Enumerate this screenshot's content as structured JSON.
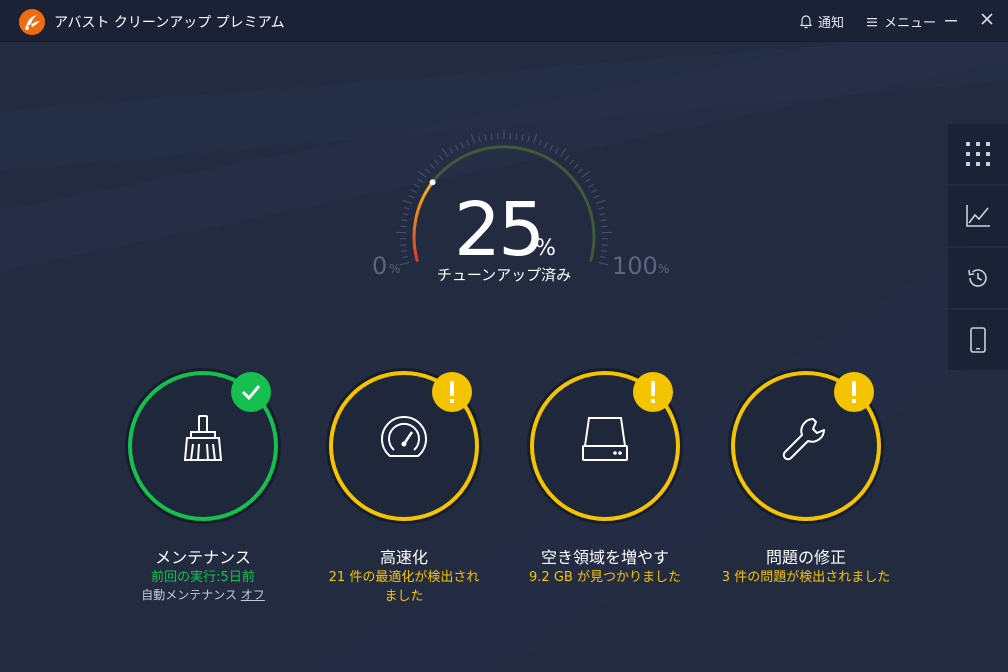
{
  "app": {
    "title": "アバスト クリーンアップ プレミアム",
    "notifications_label": "通知",
    "menu_label": "メニュー"
  },
  "colors": {
    "background": "#222b40",
    "titlebar": "#1b2235",
    "ok": "#15c04f",
    "warning": "#f5c400"
  },
  "gauge": {
    "value": 25,
    "value_text": "25",
    "percent_sign": "%",
    "label": "チューンアップ済み",
    "min": "0",
    "max": "100",
    "unit": "%"
  },
  "sidebar": {
    "items": [
      {
        "icon": "grid-icon"
      },
      {
        "icon": "chart-icon"
      },
      {
        "icon": "history-icon"
      },
      {
        "icon": "mobile-icon"
      }
    ]
  },
  "cards": [
    {
      "title": "メンテナンス",
      "subtitle": "前回の実行:5日前",
      "auto_label": "自動メンテナンス",
      "auto_state": "オフ",
      "status": "ok",
      "icon": "broom-icon"
    },
    {
      "title": "高速化",
      "subtitle": "21 件の最適化が検出されました",
      "status": "warning",
      "icon": "speedometer-icon"
    },
    {
      "title": "空き領域を増やす",
      "subtitle": "9.2 GB が見つかりました",
      "status": "warning",
      "icon": "drive-icon"
    },
    {
      "title": "問題の修正",
      "subtitle": "3 件の問題が検出されました",
      "status": "warning",
      "icon": "wrench-icon"
    }
  ]
}
